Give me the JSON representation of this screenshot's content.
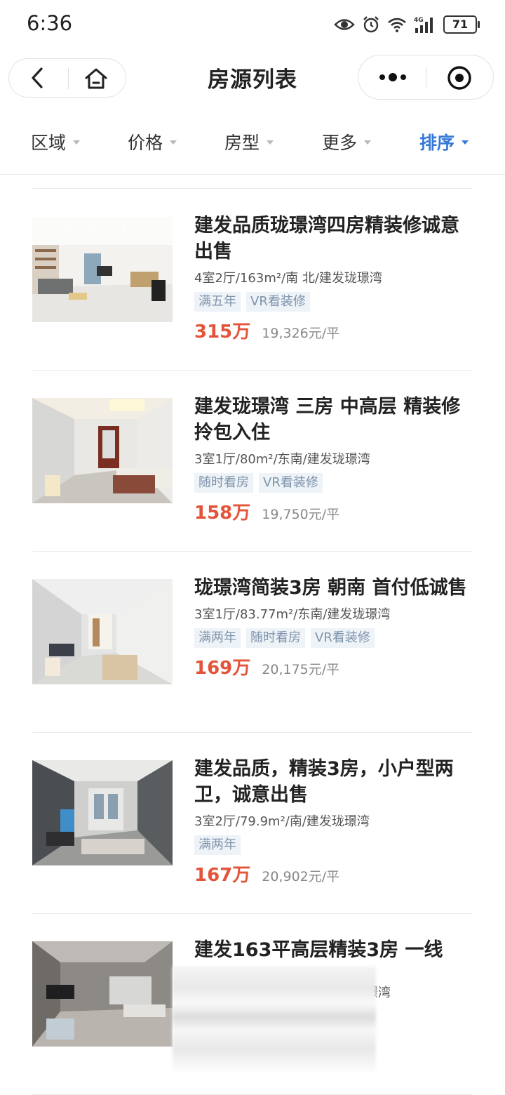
{
  "status": {
    "time": "6:36",
    "battery": "71"
  },
  "nav": {
    "title": "房源列表"
  },
  "filters": [
    {
      "label": "区域",
      "active": false
    },
    {
      "label": "价格",
      "active": false
    },
    {
      "label": "房型",
      "active": false
    },
    {
      "label": "更多",
      "active": false
    },
    {
      "label": "排序",
      "active": true
    }
  ],
  "listings": [
    {
      "title": "建发品质珑璟湾四房精装修诚意出售",
      "meta": "4室2厅/163m²/南 北/建发珑璟湾",
      "tags": [
        "满五年",
        "VR看装修"
      ],
      "price": "315万",
      "unit_price": "19,326元/平"
    },
    {
      "title": "建发珑璟湾 三房 中高层 精装修拎包入住",
      "meta": "3室1厅/80m²/东南/建发珑璟湾",
      "tags": [
        "随时看房",
        "VR看装修"
      ],
      "price": "158万",
      "unit_price": "19,750元/平"
    },
    {
      "title": "珑璟湾简装3房 朝南 首付低诚售",
      "meta": "3室1厅/83.77m²/东南/建发珑璟湾",
      "tags": [
        "满两年",
        "随时看房",
        "VR看装修"
      ],
      "price": "169万",
      "unit_price": "20,175元/平"
    },
    {
      "title": "建发品质，精装3房，小户型两卫，诚意出售",
      "meta": "3室2厅/79.9m²/南/建发珑璟湾",
      "tags": [
        "满两年"
      ],
      "price": "167万",
      "unit_price": "20,902元/平"
    },
    {
      "title": "建发163平高层精装3房 一线",
      "meta": "发珑璟湾",
      "tags": [],
      "price": "",
      "unit_price": ""
    }
  ],
  "colors": {
    "accent": "#3579d6",
    "price": "#e3543a",
    "tag_bg": "#eef3f8",
    "tag_text": "#7e93ab"
  }
}
